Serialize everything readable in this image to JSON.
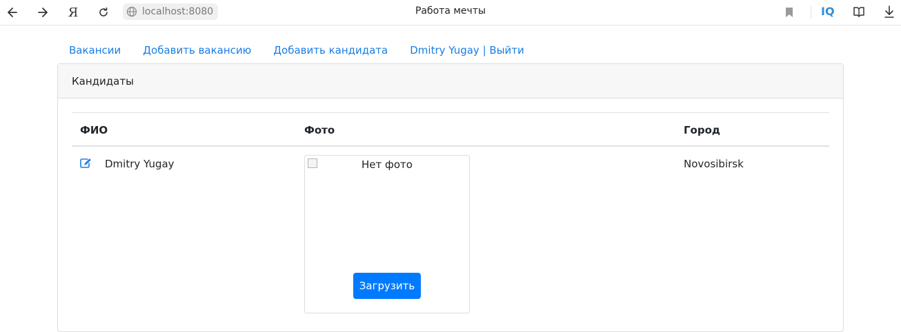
{
  "browser": {
    "url": "localhost:8080",
    "tab_title": "Работа мечты",
    "iq_label": "IQ",
    "yandex_label": "Я"
  },
  "nav": {
    "items": [
      {
        "label": "Вакансии"
      },
      {
        "label": "Добавить вакансию"
      },
      {
        "label": "Добавить кандидата"
      },
      {
        "label": "Dmitry Yugay | Выйти"
      }
    ]
  },
  "card": {
    "title": "Кандидаты",
    "columns": [
      "ФИО",
      "Фото",
      "Город"
    ],
    "rows": [
      {
        "name": "Dmitry Yugay",
        "photo_alt": "Нет фото",
        "upload_label": "Загрузить",
        "city": "Novosibirsk"
      }
    ]
  },
  "colors": {
    "link": "#1a7de3",
    "primary_button": "#007bff"
  }
}
